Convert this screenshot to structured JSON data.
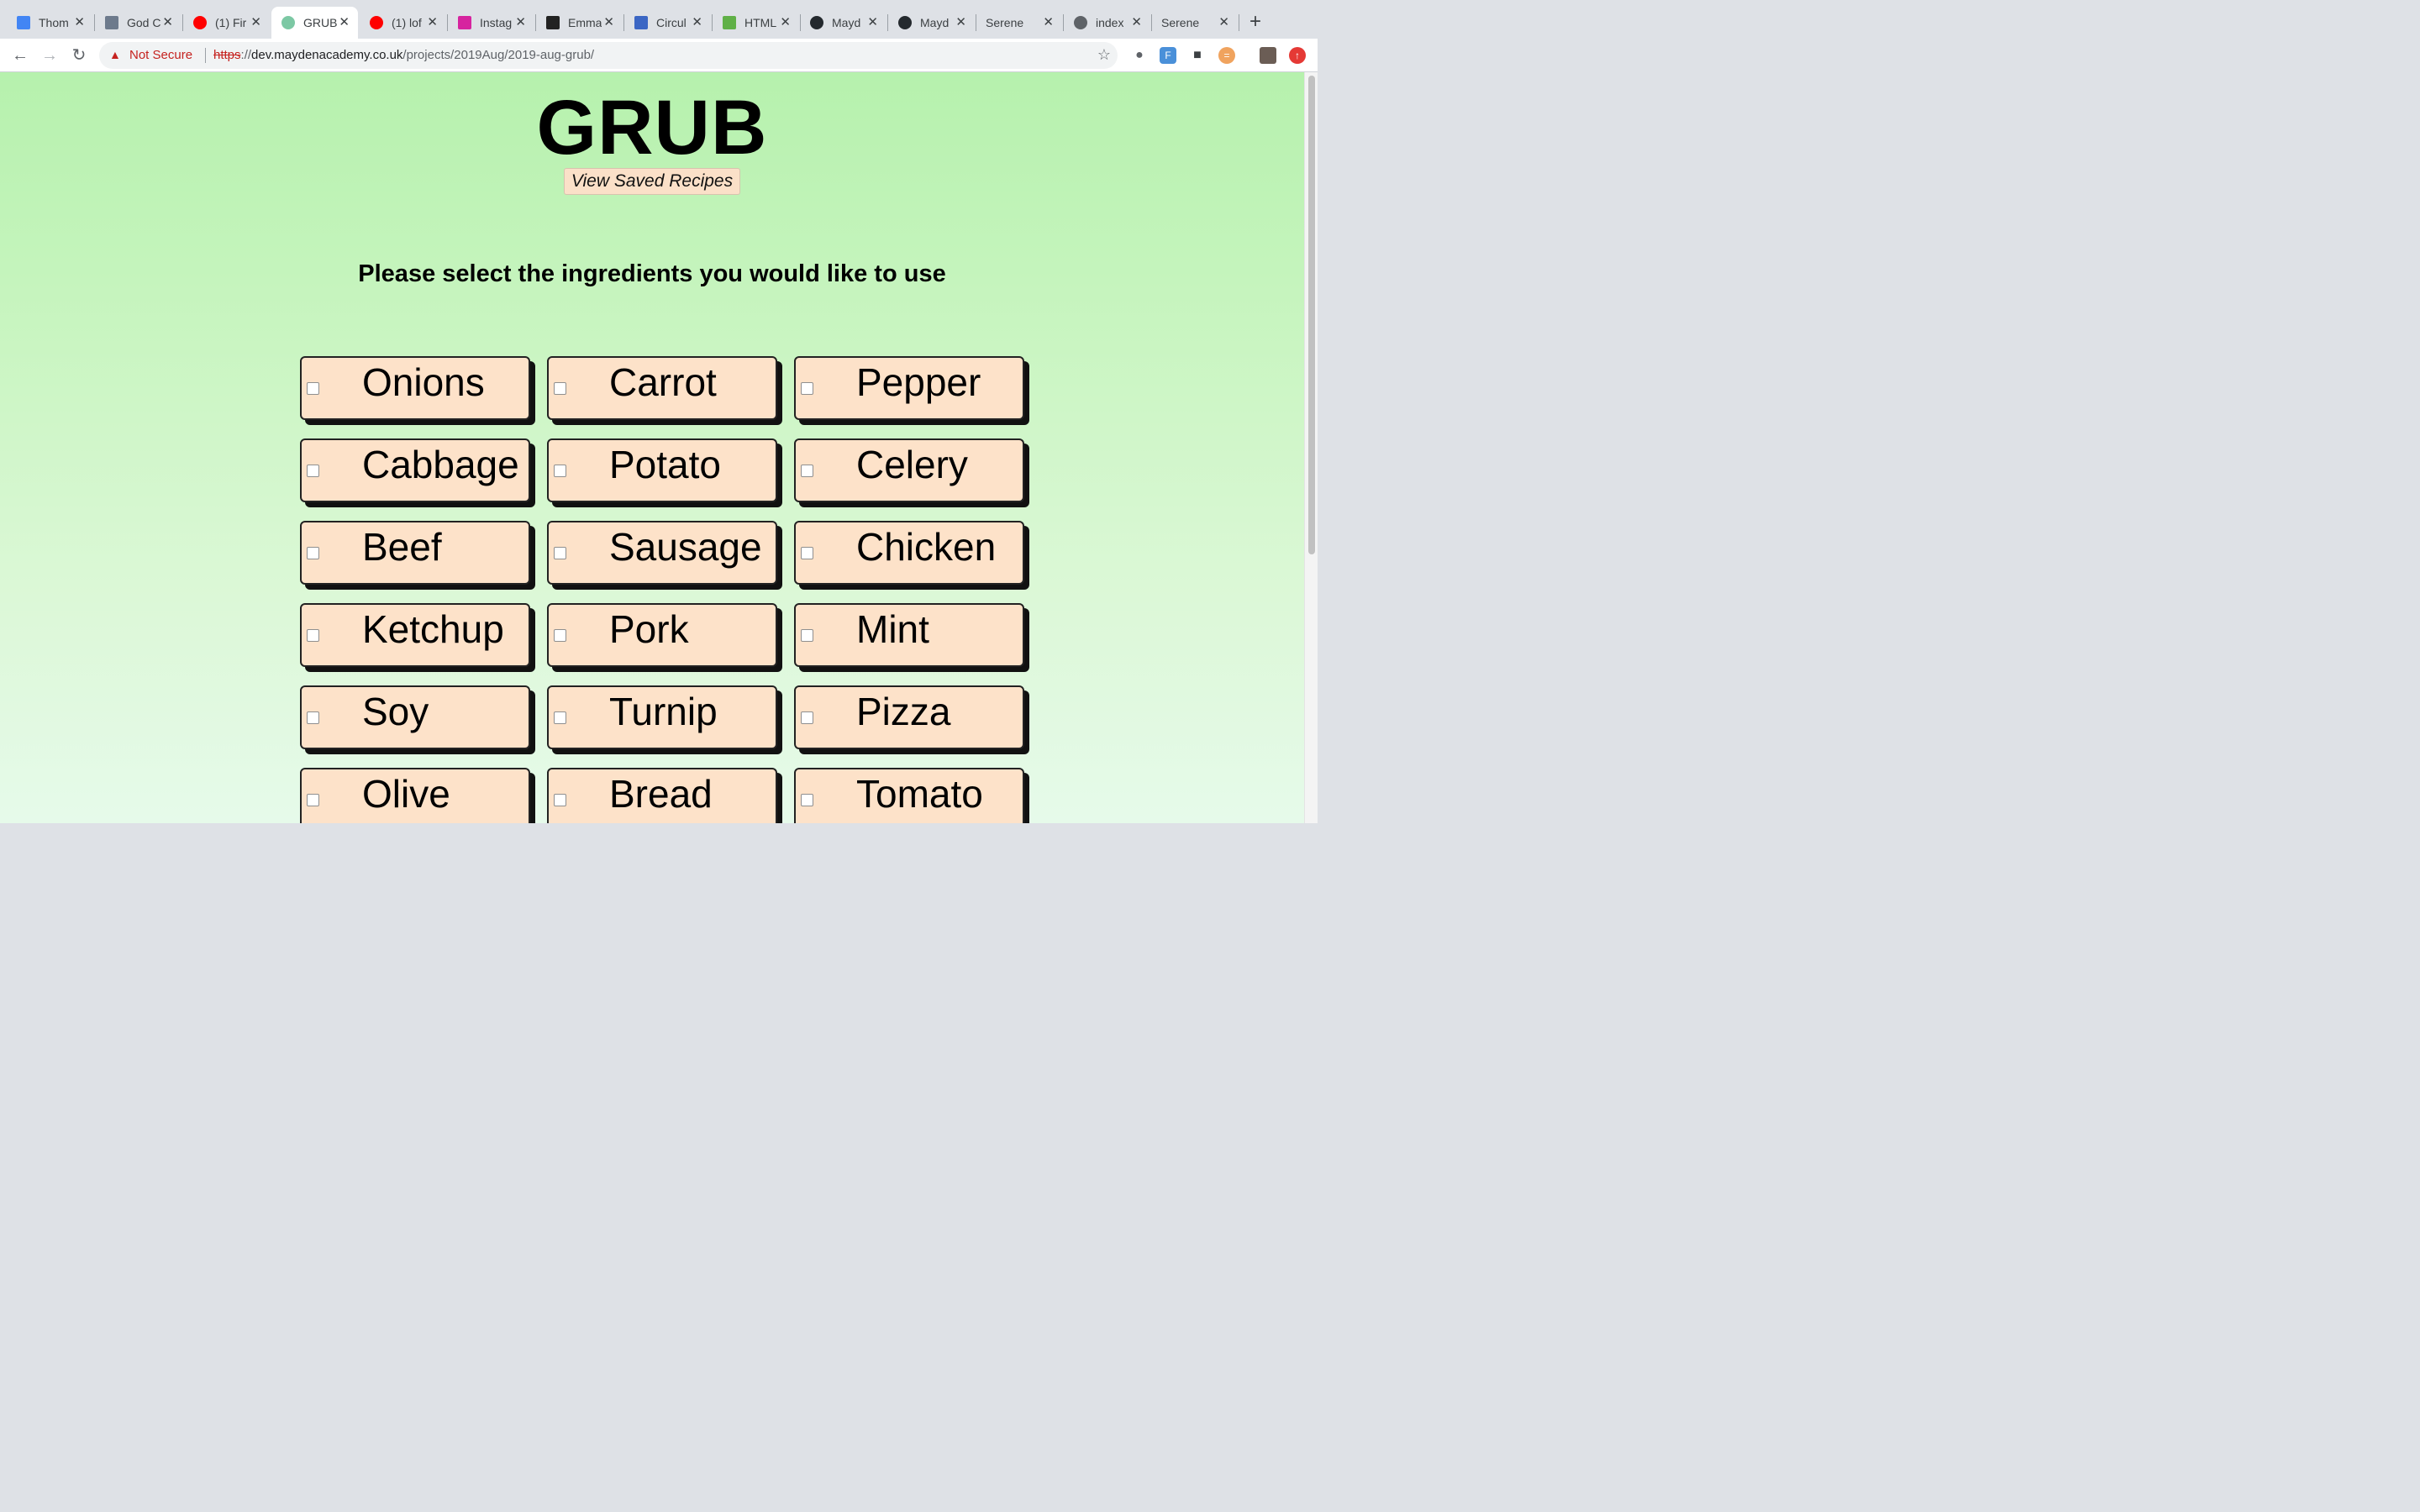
{
  "tabs": [
    {
      "title": "Thom",
      "icon": "google-docs-icon",
      "color": "#4285f4"
    },
    {
      "title": "God C",
      "icon": "person-icon",
      "color": "#6d7a8c"
    },
    {
      "title": "(1) Fir",
      "icon": "youtube-icon",
      "color": "#ff0000"
    },
    {
      "title": "GRUB",
      "icon": "grub-site-icon",
      "color": "#7cc8a4",
      "active": true
    },
    {
      "title": "(1) lof",
      "icon": "youtube-icon",
      "color": "#ff0000"
    },
    {
      "title": "Instag",
      "icon": "instagram-icon",
      "color": "#d6249f"
    },
    {
      "title": "Emma",
      "icon": "typeform-icon",
      "color": "#222222"
    },
    {
      "title": "Circul",
      "icon": "fx-icon",
      "color": "#3b66c4"
    },
    {
      "title": "HTML",
      "icon": "html-badge-icon",
      "color": "#60b047"
    },
    {
      "title": "Mayd",
      "icon": "github-icon",
      "color": "#24292e"
    },
    {
      "title": "Mayd",
      "icon": "github-icon",
      "color": "#24292e"
    },
    {
      "title": "Serene Ex",
      "icon": "none",
      "color": ""
    },
    {
      "title": "index",
      "icon": "globe-icon",
      "color": "#5f6368"
    },
    {
      "title": "Serene Ex",
      "icon": "none",
      "color": ""
    }
  ],
  "toolbar": {
    "not_secure": "Not Secure",
    "url_scheme": "https",
    "url_sep": "://",
    "url_host": "dev.maydenacademy.co.uk",
    "url_path": "/projects/2019Aug/2019-aug-grub/"
  },
  "page": {
    "title": "GRUB",
    "saved_button": "View Saved Recipes",
    "prompt": "Please select the ingredients you would like to use",
    "ingredients": [
      "Onions",
      "Carrot",
      "Pepper",
      "Cabbage",
      "Potato",
      "Celery",
      "Beef",
      "Sausage",
      "Chicken",
      "Ketchup",
      "Pork",
      "Mint",
      "Soy",
      "Turnip",
      "Pizza",
      "Olive",
      "Bread",
      "Tomato"
    ]
  },
  "colors": {
    "card_bg": "#fde2c9",
    "page_bg_top": "#b6f1ad",
    "warning_red": "#c5221f"
  }
}
